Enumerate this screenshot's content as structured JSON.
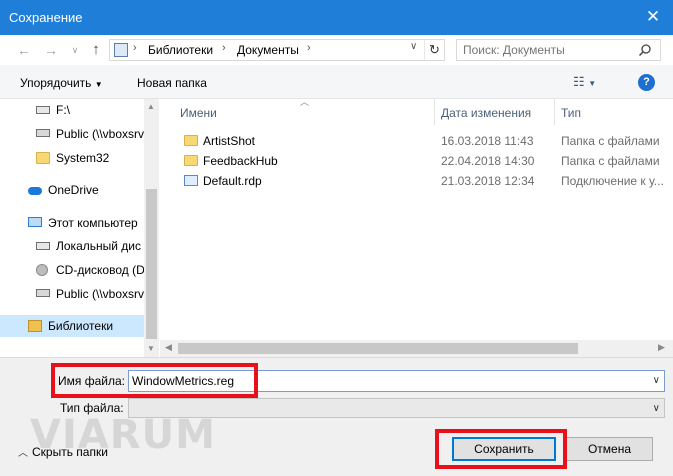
{
  "window": {
    "title": "Сохранение",
    "close_glyph": "✕"
  },
  "address": {
    "breadcrumbs": [
      "Библиотеки",
      "Документы"
    ],
    "separator": "›",
    "search_placeholder": "Поиск: Документы"
  },
  "toolbar": {
    "organize": "Упорядочить",
    "new_folder": "Новая папка"
  },
  "nav": {
    "items": [
      {
        "label": "F:\\",
        "icon": "drive-icon"
      },
      {
        "label": "Public (\\\\vboxsrv",
        "icon": "network-drive-icon"
      },
      {
        "label": "System32",
        "icon": "folder-icon"
      },
      {
        "label": "OneDrive",
        "icon": "onedrive-icon"
      },
      {
        "label": "Этот компьютер",
        "icon": "computer-icon"
      },
      {
        "label": "Локальный дис",
        "icon": "local-disk-icon"
      },
      {
        "label": "CD-дисковод (D",
        "icon": "cd-drive-icon"
      },
      {
        "label": "Public (\\\\vboxsrv",
        "icon": "network-drive-icon"
      },
      {
        "label": "Библиотеки",
        "icon": "libraries-icon"
      }
    ]
  },
  "files": {
    "columns": {
      "name": "Имени",
      "date": "Дата изменения",
      "type": "Тип"
    },
    "rows": [
      {
        "name": "ArtistShot",
        "date": "16.03.2018 11:43",
        "type": "Папка с файлами",
        "icon": "folder-icon"
      },
      {
        "name": "FeedbackHub",
        "date": "22.04.2018 14:30",
        "type": "Папка с файлами",
        "icon": "folder-icon"
      },
      {
        "name": "Default.rdp",
        "date": "21.03.2018 12:34",
        "type": "Подключение к у...",
        "icon": "rdp-file-icon"
      }
    ]
  },
  "form": {
    "filename_label": "Имя файла:",
    "filename_value": "WindowMetrics.reg",
    "filetype_label": "Тип файла:",
    "filetype_value": ""
  },
  "footer": {
    "hide_folders": "Скрыть папки",
    "save": "Сохранить",
    "cancel": "Отмена",
    "watermark": "VIARUM"
  },
  "colors": {
    "titlebar": "#1f7fd8",
    "highlight": "#e8101b",
    "selected": "#cce8ff",
    "accent": "#0078d7"
  }
}
